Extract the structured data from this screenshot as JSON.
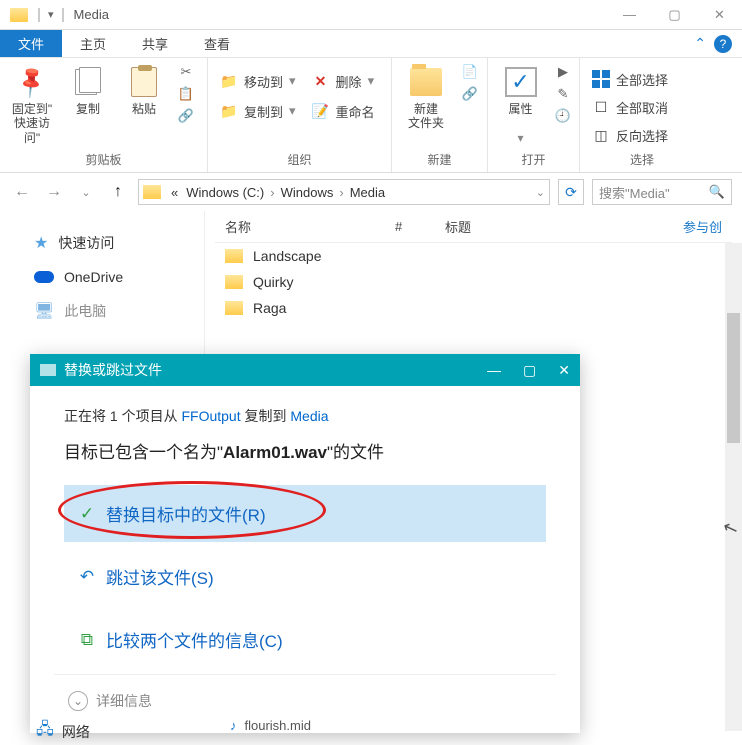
{
  "titlebar": {
    "title": "Media"
  },
  "tabs": {
    "file": "文件",
    "home": "主页",
    "share": "共享",
    "view": "查看"
  },
  "ribbon": {
    "clipboard": {
      "pin1": "固定到\"",
      "pin2": "快速访问\"",
      "copy": "复制",
      "paste": "粘贴",
      "group": "剪贴板"
    },
    "organize": {
      "moveTo": "移动到",
      "delete": "删除",
      "copyTo": "复制到",
      "rename": "重命名",
      "group": "组织"
    },
    "new_": {
      "folder1": "新建",
      "folder2": "文件夹",
      "group": "新建"
    },
    "open": {
      "props": "属性",
      "group": "打开"
    },
    "select": {
      "all": "全部选择",
      "none": "全部取消",
      "invert": "反向选择",
      "group": "选择"
    }
  },
  "address": {
    "crumbPrefix": "«",
    "c1": "Windows (C:)",
    "c2": "Windows",
    "c3": "Media",
    "searchPlaceholder": "搜索\"Media\""
  },
  "sidebar": {
    "quick": "快速访问",
    "onedrive": "OneDrive",
    "thispc": "此电脑",
    "network": "网络"
  },
  "columns": {
    "name": "名称",
    "num": "#",
    "title": "标题",
    "contrib": "参与创"
  },
  "files": [
    "Landscape",
    "Quirky",
    "Raga"
  ],
  "dialog": {
    "title": "替换或跳过文件",
    "line1a": "正在将 1 个项目从 ",
    "src": "FFOutput",
    "line1b": " 复制到 ",
    "dst": "Media",
    "line2a": "目标已包含一个名为\"",
    "fname": "Alarm01.wav",
    "line2b": "\"的文件",
    "opt1": "替换目标中的文件(R)",
    "opt2": "跳过该文件(S)",
    "opt3": "比较两个文件的信息(C)",
    "details": "详细信息"
  },
  "bottom": {
    "file": "flourish.mid"
  }
}
